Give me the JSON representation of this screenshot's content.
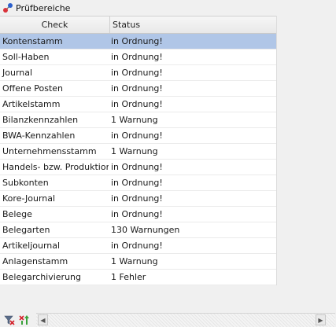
{
  "panel": {
    "title": "Prüfbereiche",
    "icon": "pruefbereiche-icon"
  },
  "table": {
    "columns": {
      "check": "Check",
      "status": "Status"
    },
    "rows": [
      {
        "check": "Kontenstamm",
        "status": "in Ordnung!",
        "selected": true
      },
      {
        "check": "Soll-Haben",
        "status": "in Ordnung!"
      },
      {
        "check": "Journal",
        "status": "in Ordnung!"
      },
      {
        "check": "Offene Posten",
        "status": "in Ordnung!"
      },
      {
        "check": "Artikelstamm",
        "status": "in Ordnung!"
      },
      {
        "check": "Bilanzkennzahlen",
        "status": "1 Warnung"
      },
      {
        "check": "BWA-Kennzahlen",
        "status": "in Ordnung!"
      },
      {
        "check": "Unternehmensstamm",
        "status": "1 Warnung"
      },
      {
        "check": "Handels- bzw. Produktion…",
        "status": "in Ordnung!"
      },
      {
        "check": "Subkonten",
        "status": "in Ordnung!"
      },
      {
        "check": "Kore-Journal",
        "status": "in Ordnung!"
      },
      {
        "check": "Belege",
        "status": "in Ordnung!"
      },
      {
        "check": "Belegarten",
        "status": "130 Warnungen"
      },
      {
        "check": "Artikeljournal",
        "status": "in Ordnung!"
      },
      {
        "check": "Anlagenstamm",
        "status": "1 Warnung"
      },
      {
        "check": "Belegarchivierung",
        "status": "1 Fehler"
      }
    ]
  },
  "toolbar": {
    "icons": [
      "filter-clear-icon",
      "sort-toggle-icon"
    ]
  },
  "colors": {
    "selected_row": "#b0c6e7",
    "background": "#f0f0f0"
  }
}
